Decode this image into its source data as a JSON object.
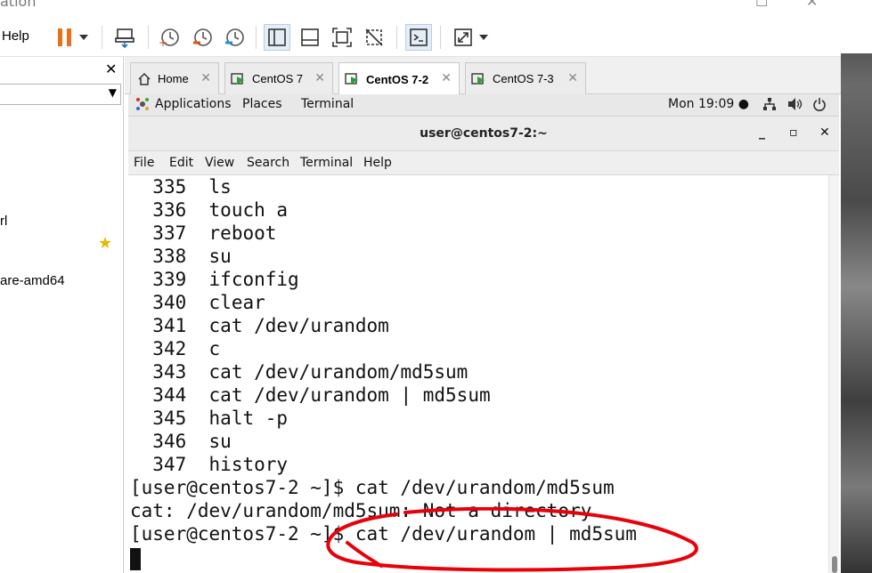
{
  "host": {
    "title_fragment": "ation",
    "help_label": "Help"
  },
  "library": {
    "items": [
      {
        "label": "rl"
      },
      {
        "label": "are-amd64"
      }
    ]
  },
  "tabs": [
    {
      "label": "Home",
      "icon": "home-icon",
      "active": false
    },
    {
      "label": "CentOS 7",
      "icon": "vm-icon",
      "active": false
    },
    {
      "label": "CentOS 7-2",
      "icon": "vm-icon",
      "active": true
    },
    {
      "label": "CentOS 7-3",
      "icon": "vm-icon",
      "active": false
    }
  ],
  "gnome_bar": {
    "applications": "Applications",
    "places": "Places",
    "terminal": "Terminal",
    "clock": "Mon 19:09 ●"
  },
  "terminal": {
    "title": "user@centos7-2:~",
    "menu": [
      "File",
      "Edit",
      "View",
      "Search",
      "Terminal",
      "Help"
    ],
    "history": [
      {
        "num": "335",
        "cmd": "ls"
      },
      {
        "num": "336",
        "cmd": "touch a"
      },
      {
        "num": "337",
        "cmd": "reboot"
      },
      {
        "num": "338",
        "cmd": "su"
      },
      {
        "num": "339",
        "cmd": "ifconfig"
      },
      {
        "num": "340",
        "cmd": "clear"
      },
      {
        "num": "341",
        "cmd": "cat /dev/urandom"
      },
      {
        "num": "342",
        "cmd": "c"
      },
      {
        "num": "343",
        "cmd": "cat /dev/urandom/md5sum"
      },
      {
        "num": "344",
        "cmd": "cat /dev/urandom | md5sum"
      },
      {
        "num": "345",
        "cmd": "halt -p"
      },
      {
        "num": "346",
        "cmd": "su"
      },
      {
        "num": "347",
        "cmd": "history"
      }
    ],
    "lines": [
      "[user@centos7-2 ~]$ cat /dev/urandom/md5sum",
      "cat: /dev/urandom/md5sum: Not a directory",
      "[user@centos7-2 ~]$ cat /dev/urandom | md5sum"
    ]
  },
  "colors": {
    "annotation": "#e8000a",
    "pause": "#e8701a"
  }
}
